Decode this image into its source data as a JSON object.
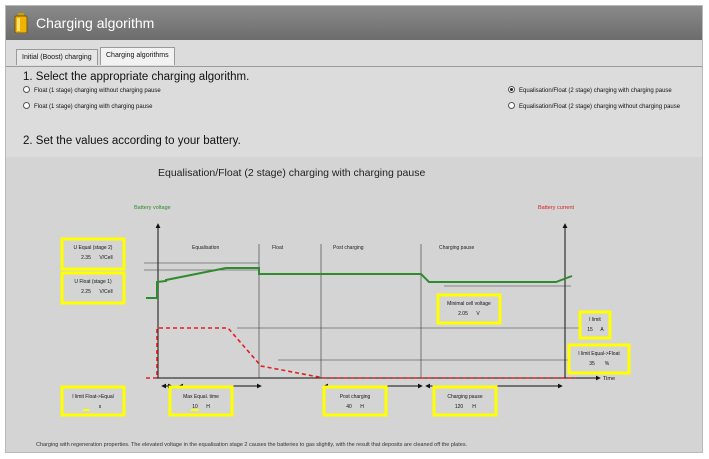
{
  "window": {
    "title": "Charging algorithm"
  },
  "tabs": [
    {
      "label": "Initial (Boost) charging"
    },
    {
      "label": "Charging algorithms"
    }
  ],
  "section1": {
    "heading": "1. Select the appropriate charging algorithm."
  },
  "radios": [
    {
      "label": "Float (1 stage) charging without charging pause",
      "checked": false
    },
    {
      "label": "Float (1 stage) charging with charging pause",
      "checked": false
    },
    {
      "label": "Equalisation/Float (2 stage) charging with charging pause",
      "checked": true
    },
    {
      "label": "Equalisation/Float (2 stage) charging without charging pause",
      "checked": false
    }
  ],
  "section2": {
    "heading": "2. Set the values according to your battery."
  },
  "diagram": {
    "title": "Equalisation/Float (2 stage) charging with charging pause",
    "battery_voltage_label": "Battery voltage",
    "battery_current_label": "Battery current",
    "time_label": "Time",
    "phases": {
      "equalisation": "Equalisation",
      "float": "Float",
      "post_charging": "Post charging",
      "charging_pause": "Charging pause"
    },
    "voltage_color": "#2e8b2e",
    "current_color": "#d42020",
    "highlight_color": "#ffff00"
  },
  "params": {
    "u_equal": {
      "label": "U Equal (stage 2)",
      "value": "2.35",
      "unit": "V/Cell"
    },
    "u_float": {
      "label": "U Float (stage 1)",
      "value": "2.25",
      "unit": "V/Cell"
    },
    "min_cell_voltage": {
      "label": "Minimal cell voltage",
      "value": "2.05",
      "unit": "V"
    },
    "i_limit": {
      "label": "I limit",
      "value": "15",
      "unit": "A"
    },
    "i_limit_equal_float": {
      "label": "I limit Equal->Float",
      "value": "35",
      "unit": "%"
    },
    "i_limit_float_equal": {
      "label": "I limit Float->Equal",
      "value": "",
      "unit": "s"
    },
    "max_equal_time": {
      "label": "Max Equal. time",
      "value": "10",
      "unit": "H"
    },
    "post_charging": {
      "label": "Post charging",
      "value": "40",
      "unit": "H"
    },
    "charging_pause": {
      "label": "Charging pause",
      "value": "120",
      "unit": "H"
    }
  },
  "footnote": "Charging with regeneration properties. The elevated voltage in the equalisation stage 2 causes the batteries to gas slightly, with the result that deposits are cleaned off the plates."
}
